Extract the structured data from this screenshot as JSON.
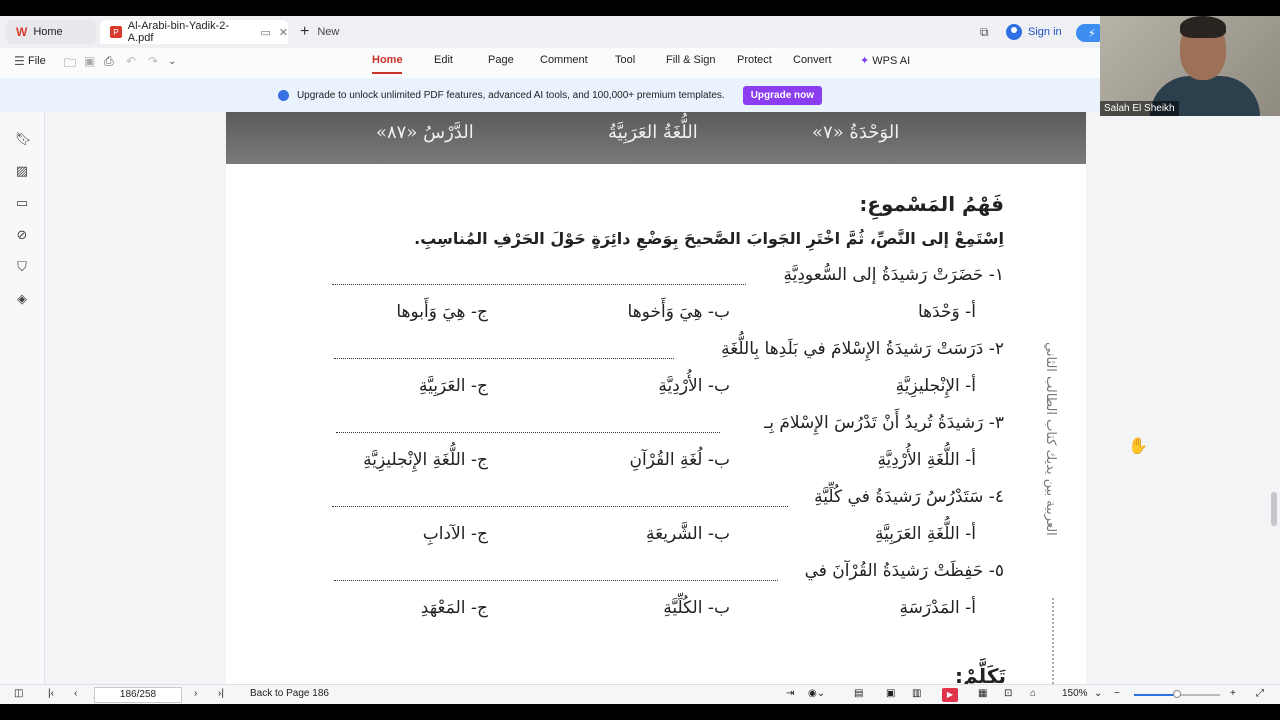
{
  "tabs": {
    "home": "Home",
    "pdf": "Al-Arabi-bin-Yadik-2-A.pdf",
    "new": "New"
  },
  "account": {
    "sign_in": "Sign in"
  },
  "toolbar": {
    "file": "File"
  },
  "menu": [
    "Home",
    "Edit",
    "Page",
    "Comment",
    "Tool",
    "Fill & Sign",
    "Protect",
    "Convert",
    "WPS AI"
  ],
  "banner": {
    "text": "Upgrade to unlock unlimited PDF features, advanced AI tools, and 100,000+ premium templates.",
    "button": "Upgrade now"
  },
  "document": {
    "header": {
      "unit": "الوَحْدَةُ  «٧»",
      "subject": "اللُّغَةُ العَرَبِيَّةُ",
      "lesson": "الدَّرْسُ  «٨٧»"
    },
    "section_title": "فَهْمُ المَسْموعِ:",
    "instruction": "اِسْتَمِعْ إلى النَّصِّ، ثُمَّ اخْتَرِ الجَوابَ الصَّحيحَ بِوَضْعِ دائِرَةٍ حَوْلَ الحَرْفِ المُناسِبِ.",
    "questions": [
      {
        "q": "١- حَضَرَتْ رَشيدَةُ إلى السُّعودِيَّةِ",
        "a": "أ- وَحْدَها",
        "b": "ب- هِيَ وَأَخوها",
        "c": "ج- هِيَ وَأَبوها"
      },
      {
        "q": "٢- دَرَسَتْ رَشيدَةُ الإِسْلامَ في بَلَدِها بِاللُّغَةِ",
        "a": "أ- الإِنْجليزِيَّةِ",
        "b": "ب- الأُرْدِيَّةِ",
        "c": "ج- العَرَبِيَّةِ"
      },
      {
        "q": "٣- رَشيدَةُ تُريدُ أَنْ تَدْرُسَ الإِسْلامَ بِـ",
        "a": "أ- اللُّغَةِ الأُرْدِيَّةِ",
        "b": "ب- لُغَةِ القُرْآنِ",
        "c": "ج- اللُّغَةِ الإِنْجليزِيَّةِ"
      },
      {
        "q": "٤- سَتَدْرُسُ رَشيدَةُ في كُلِّيَّةِ",
        "a": "أ- اللُّغَةِ العَرَبِيَّةِ",
        "b": "ب- الشَّريعَةِ",
        "c": "ج- الآدابِ"
      },
      {
        "q": "٥- حَفِظَتْ رَشيدَةُ القُرْآنَ في",
        "a": "أ- المَدْرَسَةِ",
        "b": "ب- الكُلِّيَّةِ",
        "c": "ج- المَعْهَدِ"
      }
    ],
    "next_section": "تَكَلَّمْ:",
    "side_text": "العربية بين يديك  كتاب الطالب الثاني"
  },
  "status": {
    "page": "186/258",
    "back": "Back to Page 186",
    "zoom": "150%",
    "zoom_fraction": 0.5
  },
  "webcam": {
    "name": "Salah El Sheikh"
  },
  "colors": {
    "accent": "#c8332a",
    "upgrade": "#8b3df0",
    "link": "#1f4fbf"
  },
  "icons": [
    "wps-logo-icon",
    "pdf-icon",
    "plus-icon",
    "window-icon",
    "user-icon",
    "bolt-icon",
    "bookmark-icon",
    "image-icon",
    "comment-icon",
    "attachment-icon",
    "stamp-icon",
    "layers-icon",
    "hand-cursor-icon"
  ]
}
